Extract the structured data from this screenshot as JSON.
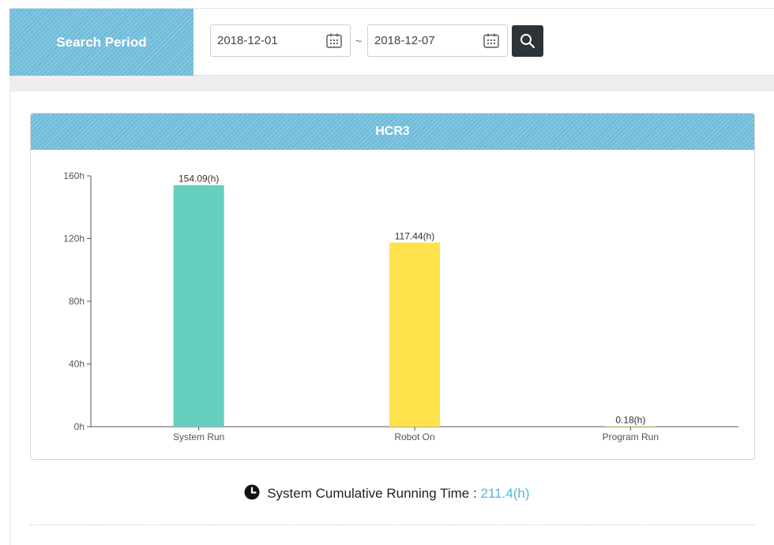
{
  "search": {
    "label": "Search Period",
    "start_date": "2018-12-01",
    "separator": "~",
    "end_date": "2018-12-07",
    "calendar_icon": "calendar-icon",
    "search_icon": "magnifier-icon"
  },
  "panel": {
    "title": "HCR3"
  },
  "chart_data": {
    "type": "bar",
    "title": "HCR3",
    "categories": [
      "System Run",
      "Robot On",
      "Program Run"
    ],
    "values": [
      154.09,
      117.44,
      0.18
    ],
    "value_labels": [
      "154.09(h)",
      "117.44(h)",
      "0.18(h)"
    ],
    "colors": [
      "#66cfbd",
      "#ffe34d",
      "#ffe34d"
    ],
    "yticks": [
      0,
      40,
      80,
      120,
      160
    ],
    "ytick_labels": [
      "0h",
      "40h",
      "80h",
      "120h",
      "160h"
    ],
    "ylim": [
      0,
      160
    ],
    "xlabel": "",
    "ylabel": "",
    "grid": false,
    "legend": "none"
  },
  "summary": {
    "icon": "clock-icon",
    "label": "System Cumulative Running Time",
    "colon": ":",
    "value": "211.4(h)"
  },
  "colors": {
    "header_blue": "#79c0de",
    "accent_value": "#4fb8d8",
    "search_button": "#2e3338"
  }
}
